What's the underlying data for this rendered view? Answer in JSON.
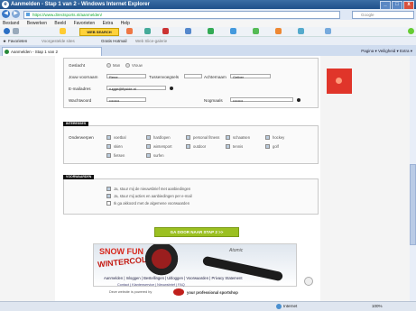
{
  "window": {
    "title": "Aanmelden - Stap 1 van 2 - Windows Internet Explorer",
    "controls": [
      "_",
      "□",
      "x"
    ]
  },
  "addressbar": {
    "url": "https://www.directsports.nl/aanmelden/",
    "search_placeholder": "Google"
  },
  "menu": [
    "Bestand",
    "Bewerken",
    "Beeld",
    "Favorieten",
    "Extra",
    "Help"
  ],
  "toolbar": {
    "websearch_label": "WEB SEARCH"
  },
  "favorites": {
    "label": "Favorieten",
    "items": [
      "Voorgestelde sites",
      "Gratis Hotmail",
      "Web Slice-galerie"
    ]
  },
  "tab": {
    "title": "Aanmelden - Stap 1 van 2",
    "tools": "Pagina ▾  Veiligheid ▾  Extra ▾"
  },
  "form": {
    "gender": {
      "label": "Geslacht",
      "options": [
        "Man",
        "Vrouw"
      ]
    },
    "firstname": {
      "label": "Jouw voornaam",
      "value": "Rene"
    },
    "middlename": {
      "label": "Tussenvoegsels",
      "value": ""
    },
    "lastname": {
      "label": "Achternaam",
      "value": "Gelber"
    },
    "email": {
      "label": "E-mailadres",
      "value": "rugge@flyside.nl"
    },
    "password": {
      "label": "Wachtwoord",
      "value": "••••••••"
    },
    "password_repeat": {
      "label": "Nogmaals",
      "value": "••••••••"
    }
  },
  "interests": {
    "header": "INTERESSES",
    "label": "Onderwerpen",
    "items": [
      [
        "voetbal",
        "hardlopen",
        "personal fitness",
        "schaatsen",
        "hockey"
      ],
      [
        "skiën",
        "wintersport",
        "outdoor",
        "tennis",
        "golf"
      ],
      [
        "fietsen",
        "surfen"
      ]
    ]
  },
  "preferences": {
    "header": "VOORWAARDEN",
    "options": [
      "Ja, stuur mij de nieuwsbrief met aanbiedingen",
      "Ja, stuur mij acties en aanbiedingen per e-mail",
      "Ik ga akkoord met de algemene voorwaarden"
    ]
  },
  "cta_label": "GA DOOR NAAR STAP 2 >>",
  "banner": {
    "headline_1": "SNOW FUN",
    "headline_2": "WINTERCOLLECTIE",
    "brand": "Atomic"
  },
  "footer": {
    "links": "Aanmelden | Inloggen | Bestellingen | Uitloggen | Voorwaarden | Privacy Statement",
    "links2": "Contact | Klantenservice | Nieuwsbrief | FAQ",
    "powered_prefix": "Deze website is powered by",
    "powered_name": "your professional sportshop"
  },
  "status": {
    "zone": "Internet",
    "zoom": "100%"
  }
}
